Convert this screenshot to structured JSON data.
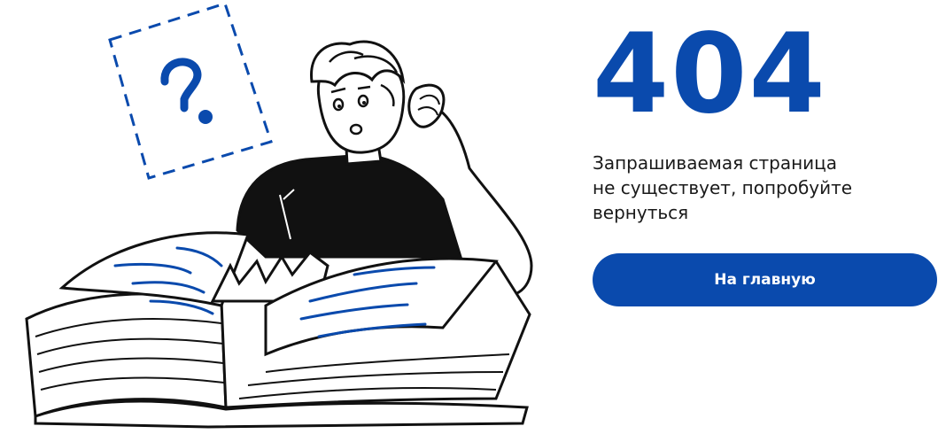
{
  "error": {
    "code": "404",
    "message_line1": "Запрашиваемая страница",
    "message_line2": "не существует, попробуйте",
    "message_line3": "вернуться"
  },
  "actions": {
    "home_label": "На главную"
  },
  "colors": {
    "accent": "#0a4aad",
    "text": "#1a1a1a",
    "background": "#ffffff"
  },
  "illustration": {
    "icon": "question-mark-icon"
  }
}
